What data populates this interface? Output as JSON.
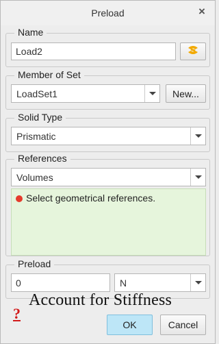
{
  "dialog": {
    "title": "Preload",
    "close_glyph": "×"
  },
  "name_group": {
    "legend": "Name",
    "value": "Load2",
    "icon": "color-picker-icon",
    "icon_color": "#f2a900"
  },
  "member_group": {
    "legend": "Member of Set",
    "selected": "LoadSet1",
    "new_button": "New..."
  },
  "solid_type_group": {
    "legend": "Solid Type",
    "selected": "Prismatic"
  },
  "references_group": {
    "legend": "References",
    "selected": "Volumes",
    "message": "Select geometrical references.",
    "message_status_color": "#e53b2c",
    "box_color": "#e6f5dc"
  },
  "preload_group": {
    "legend": "Preload",
    "value": "0",
    "unit": "N"
  },
  "overlay": {
    "watermark_text": "Account for Stiffness"
  },
  "footer": {
    "help_glyph": "?",
    "ok_label": "OK",
    "cancel_label": "Cancel",
    "ok_color": "#bde6f7"
  }
}
